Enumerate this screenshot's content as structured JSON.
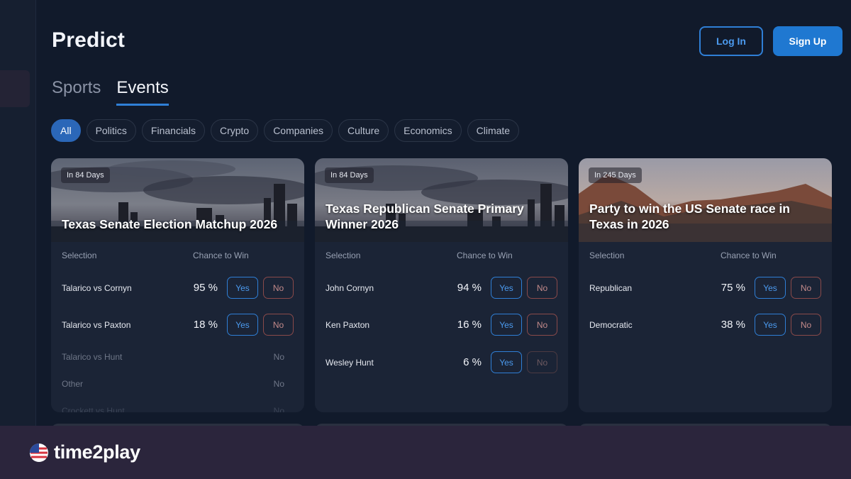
{
  "header": {
    "title": "Predict",
    "login_label": "Log In",
    "signup_label": "Sign Up"
  },
  "tabs": [
    {
      "label": "Sports",
      "active": false
    },
    {
      "label": "Events",
      "active": true
    }
  ],
  "filters": [
    {
      "label": "All",
      "active": true
    },
    {
      "label": "Politics",
      "active": false
    },
    {
      "label": "Financials",
      "active": false
    },
    {
      "label": "Crypto",
      "active": false
    },
    {
      "label": "Companies",
      "active": false
    },
    {
      "label": "Culture",
      "active": false
    },
    {
      "label": "Economics",
      "active": false
    },
    {
      "label": "Climate",
      "active": false
    }
  ],
  "columns": {
    "selection": "Selection",
    "chance": "Chance to Win"
  },
  "markets": [
    {
      "days": "In 84 Days",
      "title": "Texas Senate Election Matchup 2026",
      "outcomes": [
        {
          "name": "Talarico vs Cornyn",
          "chance": "95 %",
          "yes": "Yes",
          "no": "No"
        },
        {
          "name": "Talarico vs Paxton",
          "chance": "18 %",
          "yes": "Yes",
          "no": "No"
        }
      ],
      "inactive": [
        {
          "name": "Talarico vs Hunt",
          "no": "No"
        },
        {
          "name": "Other",
          "no": "No"
        },
        {
          "name": "Crockett vs Hunt",
          "no": "No"
        }
      ]
    },
    {
      "days": "In 84 Days",
      "title": "Texas Republican Senate Primary Winner 2026",
      "outcomes": [
        {
          "name": "John Cornyn",
          "chance": "94 %",
          "yes": "Yes",
          "no": "No"
        },
        {
          "name": "Ken Paxton",
          "chance": "16 %",
          "yes": "Yes",
          "no": "No"
        },
        {
          "name": "Wesley Hunt",
          "chance": "6 %",
          "yes": "Yes",
          "no": "No"
        }
      ]
    },
    {
      "days": "In 245 Days",
      "title": "Party to win the US Senate race in Texas in 2026",
      "outcomes": [
        {
          "name": "Republican",
          "chance": "75 %",
          "yes": "Yes",
          "no": "No"
        },
        {
          "name": "Democratic",
          "chance": "38 %",
          "yes": "Yes",
          "no": "No"
        }
      ]
    }
  ],
  "footer": {
    "logo_text": "time2play"
  },
  "colors": {
    "accent": "#1f78d1",
    "background": "#111a2b",
    "footer": "#2b253c"
  }
}
